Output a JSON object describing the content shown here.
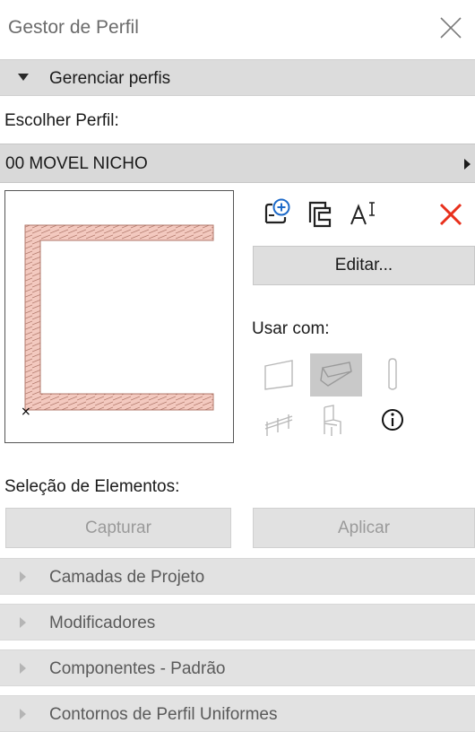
{
  "window": {
    "title": "Gestor de Perfil"
  },
  "manage_section": {
    "label": "Gerenciar perfis",
    "expanded": true
  },
  "profile": {
    "choose_label": "Escolher Perfil:",
    "selected": "00 MOVEL NICHO"
  },
  "actions": {
    "new_icon": "new-profile-icon",
    "duplicate_icon": "duplicate-profile-icon",
    "rename_icon": "rename-profile-icon",
    "delete_icon": "delete-profile-icon",
    "edit_label": "Editar...",
    "delete_color": "#e8301c"
  },
  "usar_com": {
    "label": "Usar com:",
    "items": [
      {
        "name": "wall-tool-icon",
        "selected": false
      },
      {
        "name": "beam-tool-icon",
        "selected": true
      },
      {
        "name": "column-tool-icon",
        "selected": false
      },
      {
        "name": "railing-tool-icon",
        "selected": false
      },
      {
        "name": "object-tool-icon",
        "selected": false
      },
      {
        "name": "info-icon",
        "selected": false
      }
    ]
  },
  "element_selection": {
    "label": "Seleção de Elementos:",
    "capture_label": "Capturar",
    "apply_label": "Aplicar"
  },
  "collapsed_sections": [
    {
      "label": "Camadas de Projeto"
    },
    {
      "label": "Modificadores"
    },
    {
      "label": "Componentes - Padrão"
    },
    {
      "label": "Contornos de Perfil Uniformes"
    }
  ]
}
